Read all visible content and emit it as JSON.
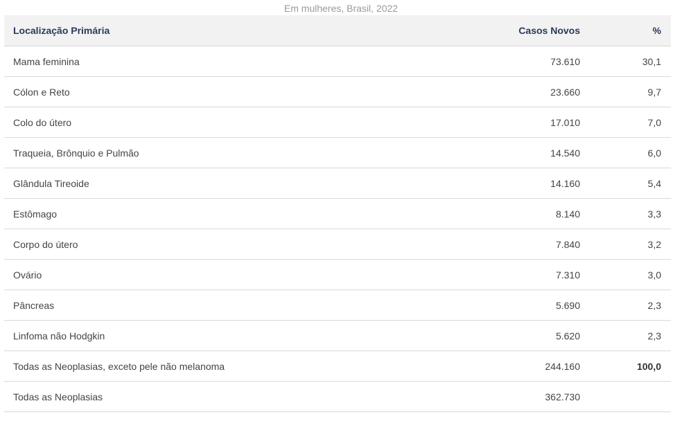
{
  "caption": "Em mulheres, Brasil, 2022",
  "table": {
    "headers": [
      "Localização Primária",
      "Casos Novos",
      "%"
    ],
    "rows": [
      {
        "location": "Mama feminina",
        "cases": "73.610",
        "percent": "30,1"
      },
      {
        "location": "Cólon e Reto",
        "cases": "23.660",
        "percent": "9,7"
      },
      {
        "location": "Colo do útero",
        "cases": "17.010",
        "percent": "7,0"
      },
      {
        "location": "Traqueia, Brônquio e Pulmão",
        "cases": "14.540",
        "percent": "6,0"
      },
      {
        "location": "Glândula Tireoide",
        "cases": "14.160",
        "percent": "5,4"
      },
      {
        "location": "Estômago",
        "cases": "8.140",
        "percent": "3,3"
      },
      {
        "location": "Corpo do útero",
        "cases": "7.840",
        "percent": "3,2"
      },
      {
        "location": "Ovário",
        "cases": "7.310",
        "percent": "3,0"
      },
      {
        "location": "Pâncreas",
        "cases": "5.690",
        "percent": "2,3"
      },
      {
        "location": "Linfoma não Hodgkin",
        "cases": "5.620",
        "percent": "2,3"
      },
      {
        "location": "Todas as Neoplasias, exceto pele não melanoma",
        "cases": "244.160",
        "percent": "100,0"
      },
      {
        "location": "Todas as Neoplasias",
        "cases": "362.730",
        "percent": ""
      }
    ]
  }
}
